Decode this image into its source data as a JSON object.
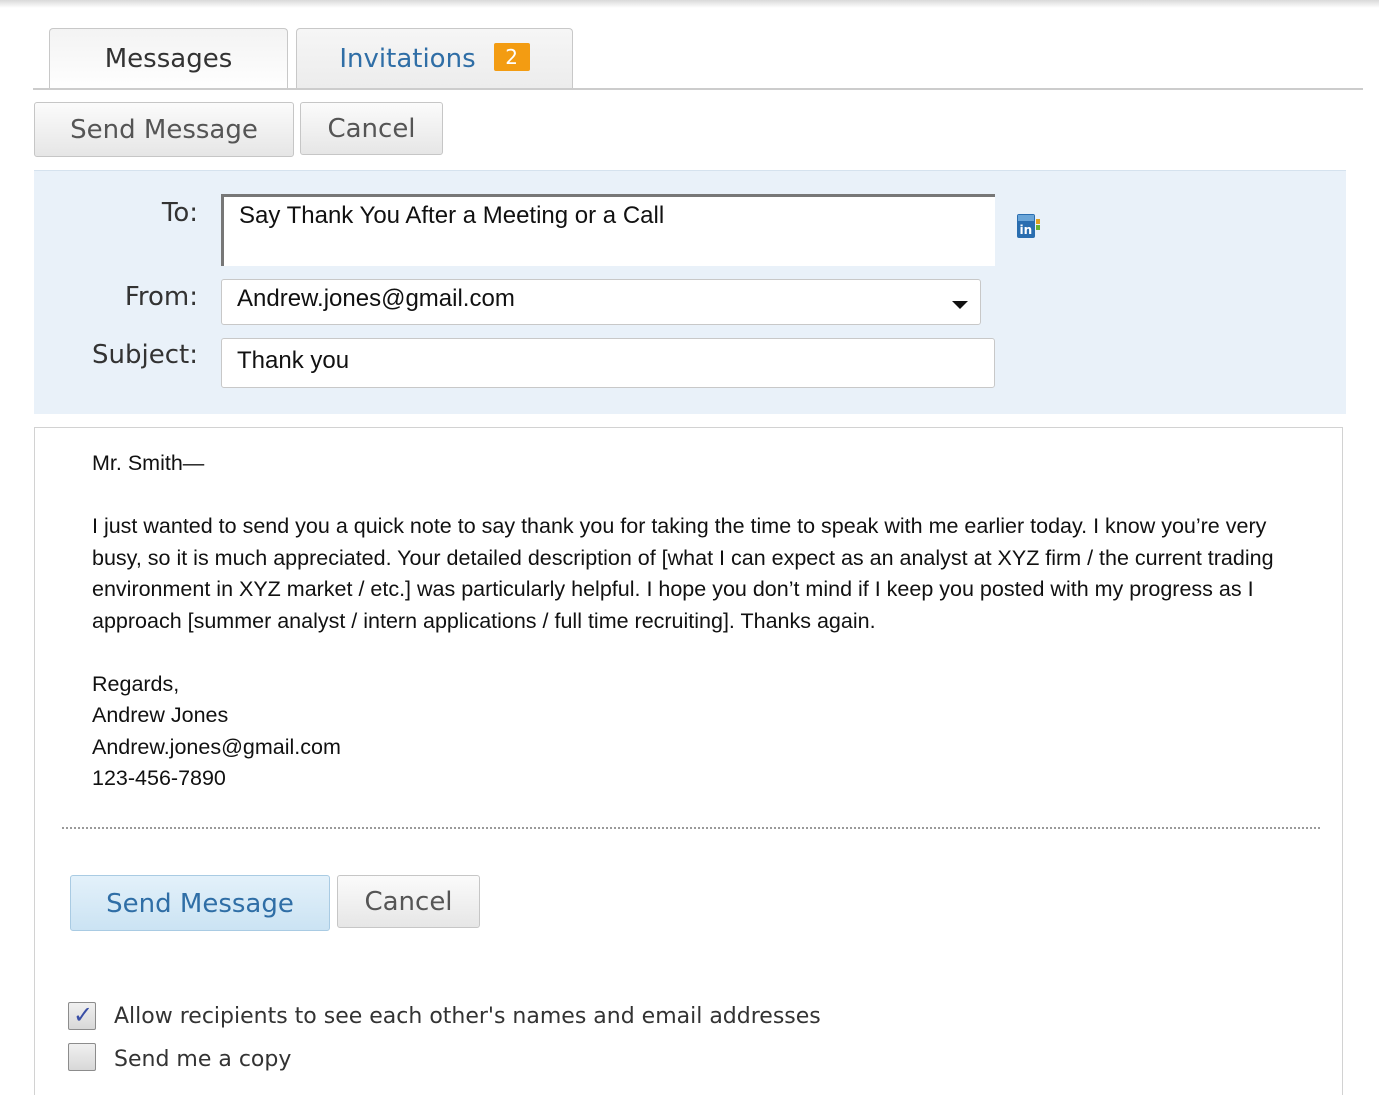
{
  "tabs": {
    "messages": "Messages",
    "invitations": "Invitations",
    "invitations_badge": "2"
  },
  "toolbar": {
    "send_label": "Send Message",
    "cancel_label": "Cancel"
  },
  "form": {
    "to_label": "To:",
    "to_value": "Say Thank You After a Meeting or a Call",
    "from_label": "From:",
    "from_value": "Andrew.jones@gmail.com",
    "subject_label": "Subject:",
    "subject_value": "Thank you",
    "address_book_icon": "linkedin-icon"
  },
  "body": {
    "greeting": "Mr. Smith—",
    "paragraph": "I just wanted to send you a quick note to say thank you for taking the time to speak with me earlier today. I know you’re very busy, so it is much appreciated. Your detailed description of [what I can expect as an analyst at XYZ firm / the current trading environment in XYZ market / etc.] was particularly helpful. I hope you don’t mind if I keep you posted with my progress as I approach [summer analyst / intern applications / full time recruiting]. Thanks again.",
    "closing": "Regards,",
    "name": "Andrew Jones",
    "email": "Andrew.jones@gmail.com",
    "phone": "123-456-7890"
  },
  "footer": {
    "send_label": "Send Message",
    "cancel_label": "Cancel"
  },
  "options": {
    "allow_label": "Allow recipients to see each other's names and email addresses",
    "allow_checked": true,
    "copy_label": "Send me a copy",
    "copy_checked": false
  },
  "colors": {
    "accent": "#2f6ea6",
    "badge": "#f39c12",
    "panel": "#e9f1f9"
  }
}
